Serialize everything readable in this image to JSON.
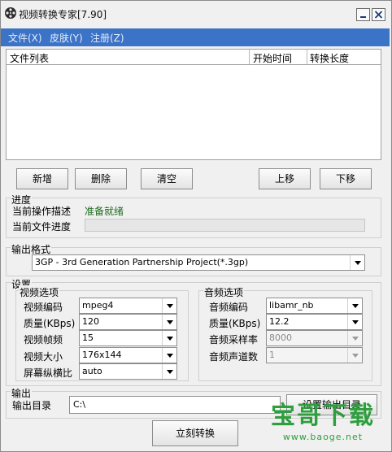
{
  "window": {
    "title": "视频转换专家[7.90]"
  },
  "menu": {
    "file": "文件(X)",
    "skin": "皮肤(Y)",
    "register": "注册(Z)"
  },
  "file_list": {
    "columns": {
      "name": "文件列表",
      "start": "开始时间",
      "length": "转换长度"
    },
    "rows": []
  },
  "buttons": {
    "add": "新增",
    "delete": "删除",
    "clear": "清空",
    "up": "上移",
    "down": "下移",
    "set_output_dir": "设置输出目录",
    "convert": "立刻转换"
  },
  "progress": {
    "title": "进度",
    "op_label": "当前操作描述",
    "op_value": "准备就绪",
    "file_label": "当前文件进度",
    "file_fraction": 0
  },
  "output_format": {
    "title": "输出格式",
    "selected": "3GP - 3rd Generation Partnership Project(*.3gp)"
  },
  "settings": {
    "title": "设置",
    "video": {
      "title": "视频选项",
      "codec_label": "视频编码",
      "codec": "mpeg4",
      "quality_label": "质量(KBps)",
      "quality": "120",
      "fps_label": "视频帧频",
      "fps": "15",
      "size_label": "视频大小",
      "size": "176x144",
      "aspect_label": "屏幕纵横比",
      "aspect": "auto"
    },
    "audio": {
      "title": "音频选项",
      "codec_label": "音频编码",
      "codec": "libamr_nb",
      "quality_label": "质量(KBps)",
      "quality": "12.2",
      "rate_label": "音频采样率",
      "rate": "8000",
      "channels_label": "音频声道数",
      "channels": "1"
    }
  },
  "output": {
    "title": "输出",
    "dir_label": "输出目录",
    "dir_value": "C:\\"
  },
  "watermark": {
    "text": "宝哥下载",
    "url": "www.baoge.net"
  },
  "colors": {
    "menubar": "#3b73c7",
    "watermark_green": "#2e9e3e",
    "status_green": "#1d6b1d"
  }
}
